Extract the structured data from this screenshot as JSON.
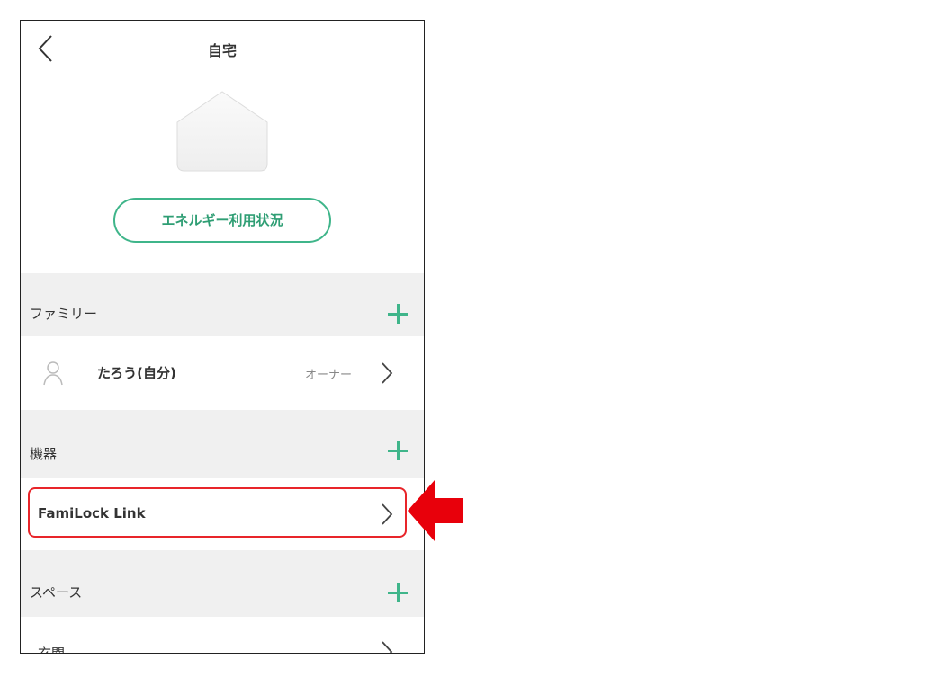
{
  "header": {
    "title": "自宅"
  },
  "energy_button": {
    "label": "エネルギー利用状況"
  },
  "family": {
    "section_label": "ファミリー",
    "member": {
      "name": "たろう(自分)",
      "role": "オーナー"
    }
  },
  "devices": {
    "section_label": "機器",
    "item": {
      "name": "FamiLock Link"
    }
  },
  "spaces": {
    "section_label": "スペース",
    "partial_item": "玄関"
  },
  "colors": {
    "accent": "#3fb58a",
    "highlight": "#e8252a",
    "section_bg": "#f0f0f0"
  },
  "icons": [
    "back-chevron-icon",
    "house-icon",
    "plus-icon",
    "user-icon",
    "chevron-right-icon",
    "red-arrow-icon"
  ]
}
